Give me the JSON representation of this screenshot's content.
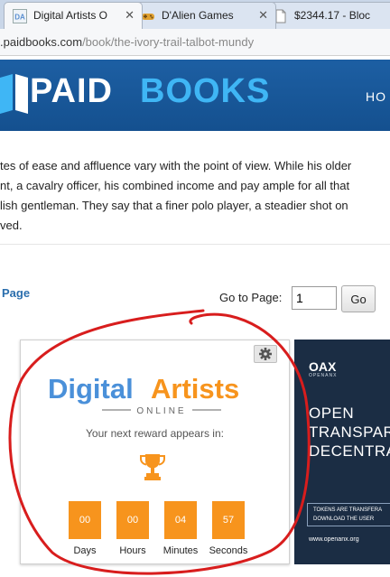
{
  "tabs": [
    {
      "title": "Digital Artists O",
      "icon": "digital-artists-favicon",
      "active": true
    },
    {
      "title": "D'Alien Games",
      "icon": "gamepad-icon",
      "active": false
    },
    {
      "title": "$2344.17 - Bloc",
      "icon": "page-icon",
      "active": false
    }
  ],
  "address": {
    "domain": ".paidbooks.com",
    "path": "/book/the-ivory-trail-talbot-mundy"
  },
  "site": {
    "brand_paid": "PAID",
    "brand_books": "BOOKS",
    "nav_home": "HO",
    "header_color": "#1d5fa3",
    "brand_accent": "#3fb6f5"
  },
  "excerpt": {
    "lines": [
      "tes of ease and affluence vary with the point of view. While his older",
      "nt, a cavalry officer, his combined income and pay ample for all that",
      "lish gentleman. They say that a finer polo player, a steadier shot on",
      "ved."
    ]
  },
  "pagination": {
    "prev_link": "Page",
    "goto_label": "Go to Page:",
    "page_value": "1",
    "go_label": "Go"
  },
  "widget": {
    "logo_word1": "Digital",
    "logo_word2": "Artists",
    "logo_sub": "ONLINE",
    "reward_text": "Your next reward appears in:",
    "accent": "#f7941d",
    "countdown": [
      {
        "value": "00",
        "label": "Days"
      },
      {
        "value": "00",
        "label": "Hours"
      },
      {
        "value": "04",
        "label": "Minutes"
      },
      {
        "value": "57",
        "label": "Seconds"
      }
    ]
  },
  "ad": {
    "logo": "OAX",
    "logo_sub": "OPENANX",
    "lines": [
      "OPEN",
      "TRANSPARE",
      "DECENTRA"
    ],
    "box_lines": [
      "TOKENS ARE TRANSFERA",
      "DOWNLOAD THE USER"
    ],
    "url": "www.openanx.org"
  }
}
